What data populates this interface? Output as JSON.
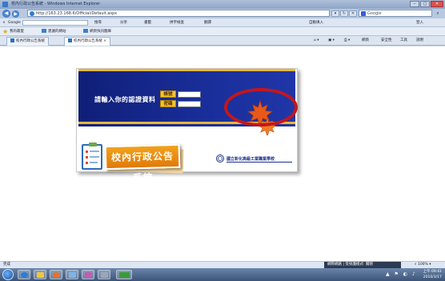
{
  "window": {
    "title": "校內行政公告系統 - Windows Internet Explorer",
    "buttons": [
      "–",
      "□",
      "✕"
    ]
  },
  "address_bar": {
    "url": "http://163.23.168.6/Official/Default.aspx",
    "search_placeholder": "Google"
  },
  "google_toolbar": {
    "label": "Google",
    "items": [
      "搜尋",
      "分享",
      "書籤",
      "拼字檢查",
      "翻譯",
      "自動填入",
      "登入"
    ]
  },
  "favorites_bar": {
    "label": "我的最愛",
    "items": [
      "建議的網站",
      "網頁快訊圖庫"
    ]
  },
  "tabs": [
    {
      "label": "校內行政公告系統"
    },
    {
      "label": "校內行政公告系統"
    }
  ],
  "command_bar": {
    "items": [
      "網頁",
      "安全性",
      "工具",
      "說明"
    ]
  },
  "login_card": {
    "prompt": "請輸入你的認證資料",
    "account_label": "帳號",
    "password_label": "密碼",
    "system_title": "校內行政公告系統",
    "school_name": "國立彰化高級工業職業學校",
    "colors": {
      "band": "#1a2e9a",
      "gold": "#e6b63c",
      "title_orange": "#e88a12",
      "highlight_circle": "#c4161c"
    }
  },
  "status_bar": {
    "left_text": "完成",
    "zone_text": "網際網路 | 受保護模式: 關閉",
    "zoom": "100%"
  },
  "taskbar": {
    "time": "上午 09:41",
    "date": "2010/3/17"
  }
}
